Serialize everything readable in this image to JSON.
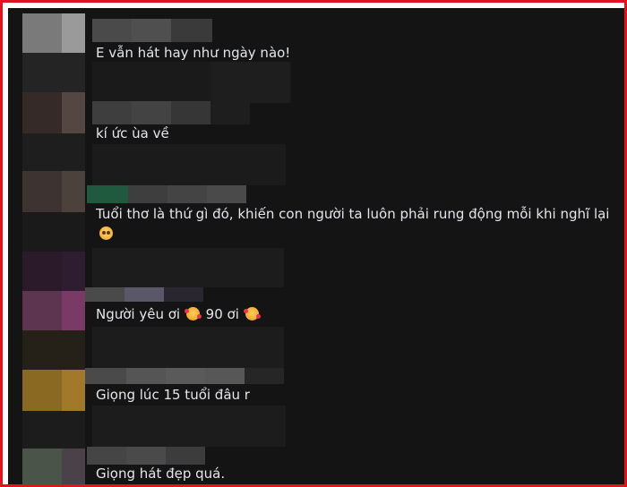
{
  "comments": [
    {
      "text": "E vẫn hát hay như ngày nào!"
    },
    {
      "text": "kí ức ùa về"
    },
    {
      "text_line1": "Tuổi thơ là thứ gì đó, khiến con người ta luôn phải rung động mỗi khi nghĩ lại",
      "emoji": "flushed-smiling-face-icon"
    },
    {
      "text_part1": "Người yêu ơi",
      "emoji1": "smiling-face-with-hearts-icon",
      "text_part2": "90 ơi",
      "emoji2": "smiling-face-with-hearts-icon"
    },
    {
      "text": "Giọng lúc 15 tuổi đâu r"
    },
    {
      "text": "Giọng hát đẹp quá."
    }
  ],
  "colors": {
    "frame_border": "#e0141e",
    "background": "#141414",
    "text": "#e4e6eb"
  }
}
